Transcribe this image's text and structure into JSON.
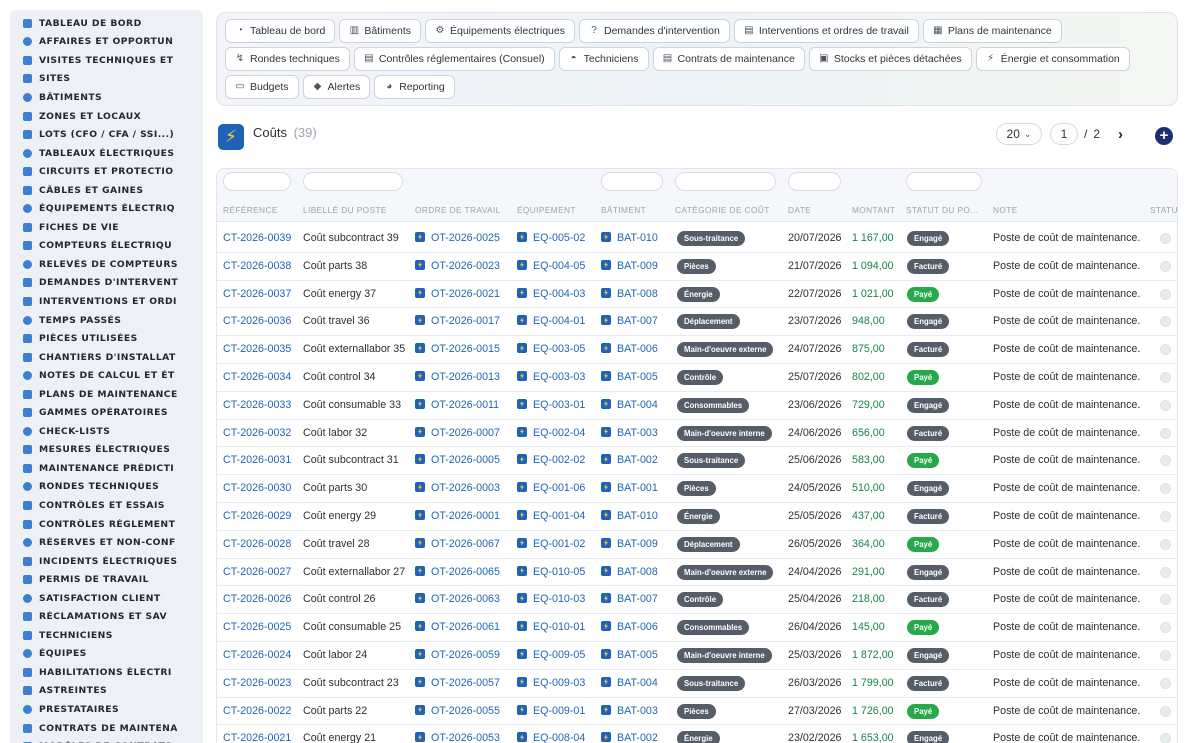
{
  "sidebar": {
    "items": [
      "TABLEAU DE BORD",
      "AFFAIRES ET OPPORTUN",
      "VISITES TECHNIQUES ET",
      "SITES",
      "BÂTIMENTS",
      "ZONES ET LOCAUX",
      "LOTS (CFO / CFA / SSI...)",
      "TABLEAUX ÉLECTRIQUES",
      "CIRCUITS ET PROTECTIO",
      "CÂBLES ET GAINES",
      "ÉQUIPEMENTS ÉLECTRIQ",
      "FICHES DE VIE",
      "COMPTEURS ÉLECTRIQU",
      "RELEVÉS DE COMPTEURS",
      "DEMANDES D'INTERVENT",
      "INTERVENTIONS ET ORDI",
      "TEMPS PASSÉS",
      "PIÈCES UTILISÉES",
      "CHANTIERS D'INSTALLAT",
      "NOTES DE CALCUL ET ÉT",
      "PLANS DE MAINTENANCE",
      "GAMMES OPÉRATOIRES",
      "CHECK-LISTS",
      "MESURES ÉLECTRIQUES",
      "MAINTENANCE PRÉDICTI",
      "RONDES TECHNIQUES",
      "CONTRÔLES ET ESSAIS",
      "CONTRÔLES RÉGLEMENT",
      "RÉSERVES ET NON-CONF",
      "INCIDENTS ÉLECTRIQUES",
      "PERMIS DE TRAVAIL",
      "SATISFACTION CLIENT",
      "RÉCLAMATIONS ET SAV",
      "TECHNICIENS",
      "ÉQUIPES",
      "HABILITATIONS ÉLECTRI",
      "ASTREINTES",
      "PRESTATAIRES",
      "CONTRATS DE MAINTENA",
      "MODÈLES DE CONTRATS"
    ]
  },
  "topnav": {
    "items": [
      {
        "label": "Tableau de bord",
        "icon": "gauge-icon",
        "glyph": "◔"
      },
      {
        "label": "Bâtiments",
        "icon": "building-icon",
        "glyph": "▥"
      },
      {
        "label": "Équipements électriques",
        "icon": "gears-icon",
        "glyph": "⚙"
      },
      {
        "label": "Demandes d'intervention",
        "icon": "question-icon",
        "glyph": "?"
      },
      {
        "label": "Interventions et ordres de travail",
        "icon": "clipboard-icon",
        "glyph": "▤"
      },
      {
        "label": "Plans de maintenance",
        "icon": "calendar-icon",
        "glyph": "▦"
      },
      {
        "label": "Rondes techniques",
        "icon": "route-icon",
        "glyph": "↯"
      },
      {
        "label": "Contrôles réglementaires (Consuel)",
        "icon": "clipboard-check-icon",
        "glyph": "▤"
      },
      {
        "label": "Techniciens",
        "icon": "helmet-icon",
        "glyph": "◓"
      },
      {
        "label": "Contrats de maintenance",
        "icon": "contract-icon",
        "glyph": "▤"
      },
      {
        "label": "Stocks et pièces détachées",
        "icon": "boxes-icon",
        "glyph": "▣"
      },
      {
        "label": "Énergie et consommation",
        "icon": "bolt-icon",
        "glyph": "⚡"
      },
      {
        "label": "Budgets",
        "icon": "money-icon",
        "glyph": "▭"
      },
      {
        "label": "Alertes",
        "icon": "bell-icon",
        "glyph": "◆"
      },
      {
        "label": "Reporting",
        "icon": "chart-pie-icon",
        "glyph": "◕"
      }
    ]
  },
  "header": {
    "title": "Coûts",
    "count": "(39)",
    "logo_icon": "bolt-logo-icon",
    "page_size": "20",
    "current_page": "1",
    "page_sep": "/",
    "total_pages": "2",
    "next_icon": "chevron-right-icon",
    "add_icon": "plus-circle-icon"
  },
  "table": {
    "columns": [
      "RÉFÉRENCE",
      "LIBELLÉ DU POSTE",
      "ORDRE DE TRAVAIL",
      "ÉQUIPEMENT",
      "BÂTIMENT",
      "CATÉGORIE DE COÛT",
      "DATE",
      "MONTANT",
      "STATUT DU PO...",
      "NOTE",
      "STATU"
    ],
    "rows": [
      {
        "ref": "CT-2026-0039",
        "label": "Coût subcontract 39",
        "ot": "OT-2026-0025",
        "eq": "EQ-005-02",
        "bat": "BAT-010",
        "cat": "Sous-traitance",
        "date": "20/07/2026",
        "amount": "1 167,00",
        "status": "Engagé",
        "note": "Poste de coût de maintenance."
      },
      {
        "ref": "CT-2026-0038",
        "label": "Coût parts 38",
        "ot": "OT-2026-0023",
        "eq": "EQ-004-05",
        "bat": "BAT-009",
        "cat": "Pièces",
        "date": "21/07/2026",
        "amount": "1 094,00",
        "status": "Facturé",
        "note": "Poste de coût de maintenance."
      },
      {
        "ref": "CT-2026-0037",
        "label": "Coût energy 37",
        "ot": "OT-2026-0021",
        "eq": "EQ-004-03",
        "bat": "BAT-008",
        "cat": "Énergie",
        "date": "22/07/2026",
        "amount": "1 021,00",
        "status": "Payé",
        "note": "Poste de coût de maintenance."
      },
      {
        "ref": "CT-2026-0036",
        "label": "Coût travel 36",
        "ot": "OT-2026-0017",
        "eq": "EQ-004-01",
        "bat": "BAT-007",
        "cat": "Déplacement",
        "date": "23/07/2026",
        "amount": "948,00",
        "status": "Engagé",
        "note": "Poste de coût de maintenance."
      },
      {
        "ref": "CT-2026-0035",
        "label": "Coût externallabor 35",
        "ot": "OT-2026-0015",
        "eq": "EQ-003-05",
        "bat": "BAT-006",
        "cat": "Main-d'oeuvre externe",
        "date": "24/07/2026",
        "amount": "875,00",
        "status": "Facturé",
        "note": "Poste de coût de maintenance."
      },
      {
        "ref": "CT-2026-0034",
        "label": "Coût control 34",
        "ot": "OT-2026-0013",
        "eq": "EQ-003-03",
        "bat": "BAT-005",
        "cat": "Contrôle",
        "date": "25/07/2026",
        "amount": "802,00",
        "status": "Payé",
        "note": "Poste de coût de maintenance."
      },
      {
        "ref": "CT-2026-0033",
        "label": "Coût consumable 33",
        "ot": "OT-2026-0011",
        "eq": "EQ-003-01",
        "bat": "BAT-004",
        "cat": "Consommables",
        "date": "23/06/2026",
        "amount": "729,00",
        "status": "Engagé",
        "note": "Poste de coût de maintenance."
      },
      {
        "ref": "CT-2026-0032",
        "label": "Coût labor 32",
        "ot": "OT-2026-0007",
        "eq": "EQ-002-04",
        "bat": "BAT-003",
        "cat": "Main-d'oeuvre interne",
        "date": "24/06/2026",
        "amount": "656,00",
        "status": "Facturé",
        "note": "Poste de coût de maintenance."
      },
      {
        "ref": "CT-2026-0031",
        "label": "Coût subcontract 31",
        "ot": "OT-2026-0005",
        "eq": "EQ-002-02",
        "bat": "BAT-002",
        "cat": "Sous-traitance",
        "date": "25/06/2026",
        "amount": "583,00",
        "status": "Payé",
        "note": "Poste de coût de maintenance."
      },
      {
        "ref": "CT-2026-0030",
        "label": "Coût parts 30",
        "ot": "OT-2026-0003",
        "eq": "EQ-001-06",
        "bat": "BAT-001",
        "cat": "Pièces",
        "date": "24/05/2026",
        "amount": "510,00",
        "status": "Engagé",
        "note": "Poste de coût de maintenance."
      },
      {
        "ref": "CT-2026-0029",
        "label": "Coût energy 29",
        "ot": "OT-2026-0001",
        "eq": "EQ-001-04",
        "bat": "BAT-010",
        "cat": "Énergie",
        "date": "25/05/2026",
        "amount": "437,00",
        "status": "Facturé",
        "note": "Poste de coût de maintenance."
      },
      {
        "ref": "CT-2026-0028",
        "label": "Coût travel 28",
        "ot": "OT-2026-0067",
        "eq": "EQ-001-02",
        "bat": "BAT-009",
        "cat": "Déplacement",
        "date": "26/05/2026",
        "amount": "364,00",
        "status": "Payé",
        "note": "Poste de coût de maintenance."
      },
      {
        "ref": "CT-2026-0027",
        "label": "Coût externallabor 27",
        "ot": "OT-2026-0065",
        "eq": "EQ-010-05",
        "bat": "BAT-008",
        "cat": "Main-d'oeuvre externe",
        "date": "24/04/2026",
        "amount": "291,00",
        "status": "Engagé",
        "note": "Poste de coût de maintenance."
      },
      {
        "ref": "CT-2026-0026",
        "label": "Coût control 26",
        "ot": "OT-2026-0063",
        "eq": "EQ-010-03",
        "bat": "BAT-007",
        "cat": "Contrôle",
        "date": "25/04/2026",
        "amount": "218,00",
        "status": "Facturé",
        "note": "Poste de coût de maintenance."
      },
      {
        "ref": "CT-2026-0025",
        "label": "Coût consumable 25",
        "ot": "OT-2026-0061",
        "eq": "EQ-010-01",
        "bat": "BAT-006",
        "cat": "Consommables",
        "date": "26/04/2026",
        "amount": "145,00",
        "status": "Payé",
        "note": "Poste de coût de maintenance."
      },
      {
        "ref": "CT-2026-0024",
        "label": "Coût labor 24",
        "ot": "OT-2026-0059",
        "eq": "EQ-009-05",
        "bat": "BAT-005",
        "cat": "Main-d'oeuvre interne",
        "date": "25/03/2026",
        "amount": "1 872,00",
        "status": "Engagé",
        "note": "Poste de coût de maintenance."
      },
      {
        "ref": "CT-2026-0023",
        "label": "Coût subcontract 23",
        "ot": "OT-2026-0057",
        "eq": "EQ-009-03",
        "bat": "BAT-004",
        "cat": "Sous-traitance",
        "date": "26/03/2026",
        "amount": "1 799,00",
        "status": "Facturé",
        "note": "Poste de coût de maintenance."
      },
      {
        "ref": "CT-2026-0022",
        "label": "Coût parts 22",
        "ot": "OT-2026-0055",
        "eq": "EQ-009-01",
        "bat": "BAT-003",
        "cat": "Pièces",
        "date": "27/03/2026",
        "amount": "1 726,00",
        "status": "Payé",
        "note": "Poste de coût de maintenance."
      },
      {
        "ref": "CT-2026-0021",
        "label": "Coût energy 21",
        "ot": "OT-2026-0053",
        "eq": "EQ-008-04",
        "bat": "BAT-002",
        "cat": "Énergie",
        "date": "23/02/2026",
        "amount": "1 653,00",
        "status": "Engagé",
        "note": "Poste de coût de maintenance."
      }
    ]
  },
  "colors": {
    "link": "#1f65b5",
    "amount": "#17834d",
    "badge_dark": "#555d68",
    "badge_paid": "#27a84a",
    "accent": "#1e2f6f"
  }
}
